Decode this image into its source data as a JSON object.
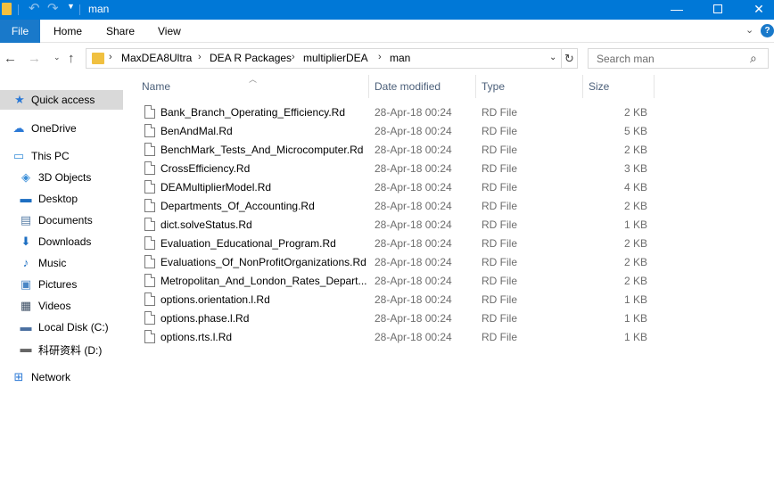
{
  "window": {
    "title": "man",
    "minimize_glyph": "—",
    "close_glyph": "✕"
  },
  "ribbon": {
    "tabs": [
      "File",
      "Home",
      "Share",
      "View"
    ]
  },
  "address": {
    "segments": [
      "MaxDEA8Ultra",
      "DEA R Packages",
      "multiplierDEA",
      "man"
    ]
  },
  "search": {
    "placeholder": "Search man"
  },
  "nav": {
    "items": [
      {
        "label": "Quick access",
        "icon": "star-icon"
      },
      {
        "label": "OneDrive",
        "icon": "cloud-icon"
      },
      {
        "label": "This PC",
        "icon": "computer-icon"
      },
      {
        "label": "3D Objects",
        "icon": "cube-icon"
      },
      {
        "label": "Desktop",
        "icon": "desktop-icon"
      },
      {
        "label": "Documents",
        "icon": "documents-icon"
      },
      {
        "label": "Downloads",
        "icon": "download-icon"
      },
      {
        "label": "Music",
        "icon": "music-icon"
      },
      {
        "label": "Pictures",
        "icon": "pictures-icon"
      },
      {
        "label": "Videos",
        "icon": "videos-icon"
      },
      {
        "label": "Local Disk (C:)",
        "icon": "drive-icon"
      },
      {
        "label": "科研资料 (D:)",
        "icon": "drive-icon"
      },
      {
        "label": "Network",
        "icon": "network-icon"
      }
    ]
  },
  "columns": {
    "name": "Name",
    "date": "Date modified",
    "type": "Type",
    "size": "Size"
  },
  "files": [
    {
      "name": "Bank_Branch_Operating_Efficiency.Rd",
      "date": "28-Apr-18 00:24",
      "type": "RD File",
      "size": "2 KB"
    },
    {
      "name": "BenAndMal.Rd",
      "date": "28-Apr-18 00:24",
      "type": "RD File",
      "size": "5 KB"
    },
    {
      "name": "BenchMark_Tests_And_Microcomputer.Rd",
      "date": "28-Apr-18 00:24",
      "type": "RD File",
      "size": "2 KB"
    },
    {
      "name": "CrossEfficiency.Rd",
      "date": "28-Apr-18 00:24",
      "type": "RD File",
      "size": "3 KB"
    },
    {
      "name": "DEAMultiplierModel.Rd",
      "date": "28-Apr-18 00:24",
      "type": "RD File",
      "size": "4 KB"
    },
    {
      "name": "Departments_Of_Accounting.Rd",
      "date": "28-Apr-18 00:24",
      "type": "RD File",
      "size": "2 KB"
    },
    {
      "name": "dict.solveStatus.Rd",
      "date": "28-Apr-18 00:24",
      "type": "RD File",
      "size": "1 KB"
    },
    {
      "name": "Evaluation_Educational_Program.Rd",
      "date": "28-Apr-18 00:24",
      "type": "RD File",
      "size": "2 KB"
    },
    {
      "name": "Evaluations_Of_NonProfitOrganizations.Rd",
      "date": "28-Apr-18 00:24",
      "type": "RD File",
      "size": "2 KB"
    },
    {
      "name": "Metropolitan_And_London_Rates_Depart...",
      "date": "28-Apr-18 00:24",
      "type": "RD File",
      "size": "2 KB"
    },
    {
      "name": "options.orientation.l.Rd",
      "date": "28-Apr-18 00:24",
      "type": "RD File",
      "size": "1 KB"
    },
    {
      "name": "options.phase.l.Rd",
      "date": "28-Apr-18 00:24",
      "type": "RD File",
      "size": "1 KB"
    },
    {
      "name": "options.rts.l.Rd",
      "date": "28-Apr-18 00:24",
      "type": "RD File",
      "size": "1 KB"
    }
  ]
}
